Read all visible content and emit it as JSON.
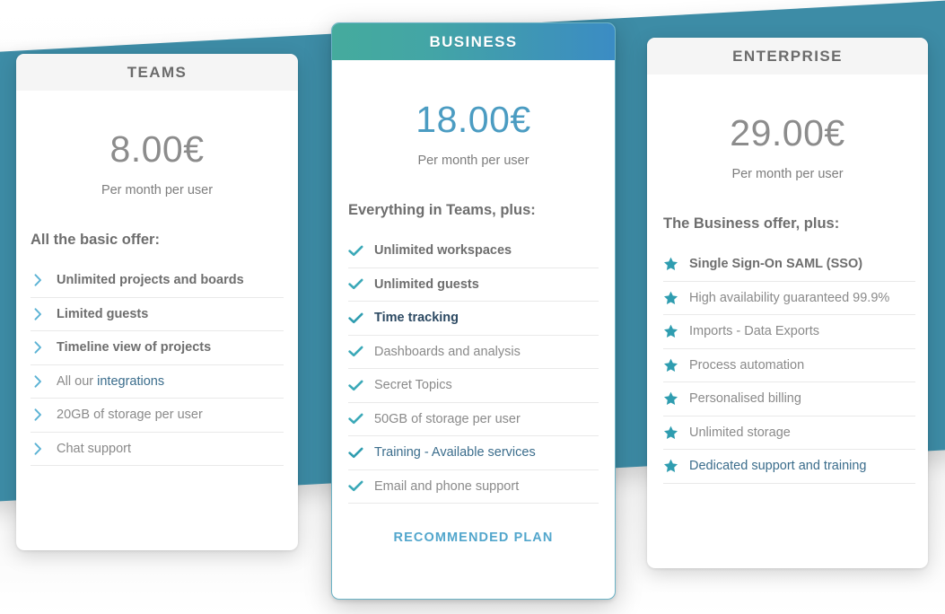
{
  "theme": {
    "ribbon_color": "#3d8ca6",
    "accent_blue": "#4b9cc2",
    "accent_teal": "#45ab9d",
    "chevron_color": "#5ab2d4",
    "check_color": "#3ba9b8",
    "star_color": "#2f9db0",
    "link_color": "#3b6d8c"
  },
  "plans": [
    {
      "id": "teams",
      "name": "TEAMS",
      "price": "8.00€",
      "price_note": "Per month per user",
      "section_title": "All the basic offer:",
      "bullet_icon": "chevron-right-icon",
      "features": [
        {
          "label": "Unlimited projects and boards",
          "style": "bold"
        },
        {
          "label": "Limited guests",
          "style": "bold"
        },
        {
          "label": "Timeline view of projects",
          "style": "bold"
        },
        {
          "label": "All our integrations",
          "style": "normal",
          "link_part": "integrations",
          "plain_part": "All our "
        },
        {
          "label": "20GB of storage per user",
          "style": "normal"
        },
        {
          "label": "Chat support",
          "style": "normal"
        }
      ],
      "cta": ""
    },
    {
      "id": "business",
      "name": "BUSINESS",
      "price": "18.00€",
      "price_note": "Per month per user",
      "section_title": "Everything in Teams, plus:",
      "bullet_icon": "check-icon",
      "features": [
        {
          "label": "Unlimited workspaces",
          "style": "bold"
        },
        {
          "label": "Unlimited guests",
          "style": "bold"
        },
        {
          "label": "Time tracking",
          "style": "bold-dark"
        },
        {
          "label": "Dashboards and analysis",
          "style": "normal"
        },
        {
          "label": "Secret Topics",
          "style": "normal"
        },
        {
          "label": "50GB of storage per user",
          "style": "normal"
        },
        {
          "label": "Training - Available services",
          "style": "link"
        },
        {
          "label": "Email and phone support",
          "style": "normal"
        }
      ],
      "cta": "RECOMMENDED PLAN"
    },
    {
      "id": "enterprise",
      "name": "ENTERPRISE",
      "price": "29.00€",
      "price_note": "Per month per user",
      "section_title": "The Business offer, plus:",
      "bullet_icon": "star-icon",
      "features": [
        {
          "label": "Single Sign-On SAML (SSO)",
          "style": "bold"
        },
        {
          "label": "High availability guaranteed 99.9%",
          "style": "normal"
        },
        {
          "label": "Imports - Data Exports",
          "style": "normal"
        },
        {
          "label": "Process automation",
          "style": "normal"
        },
        {
          "label": "Personalised billing",
          "style": "normal"
        },
        {
          "label": "Unlimited storage",
          "style": "normal"
        },
        {
          "label": "Dedicated support and training",
          "style": "link"
        }
      ],
      "cta": ""
    }
  ]
}
